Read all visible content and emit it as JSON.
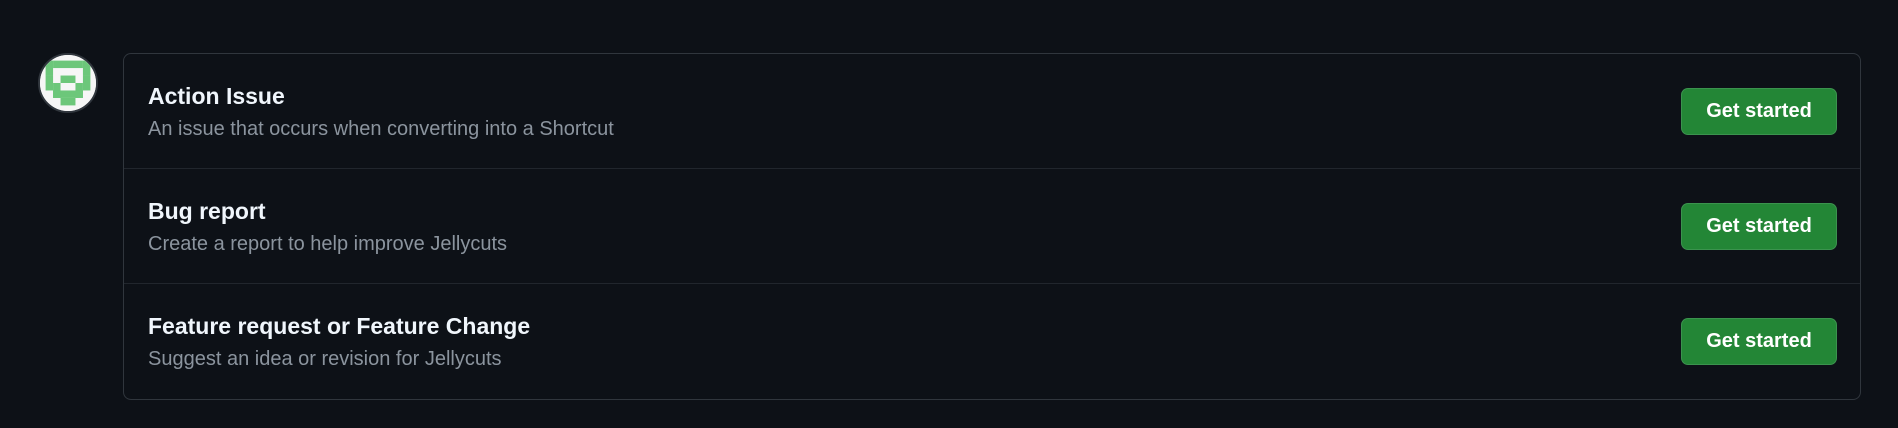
{
  "avatar": {
    "icon": "identicon",
    "color": "#6cc77a"
  },
  "templates": [
    {
      "title": "Action Issue",
      "description": "An issue that occurs when converting into a Shortcut",
      "button_label": "Get started"
    },
    {
      "title": "Bug report",
      "description": "Create a report to help improve Jellycuts",
      "button_label": "Get started"
    },
    {
      "title": "Feature request or Feature Change",
      "description": "Suggest an idea or revision for Jellycuts",
      "button_label": "Get started"
    }
  ],
  "colors": {
    "background": "#0d1117",
    "border": "#30363d",
    "button": "#238636",
    "title": "#f0f6fc",
    "muted": "#8b949e"
  }
}
